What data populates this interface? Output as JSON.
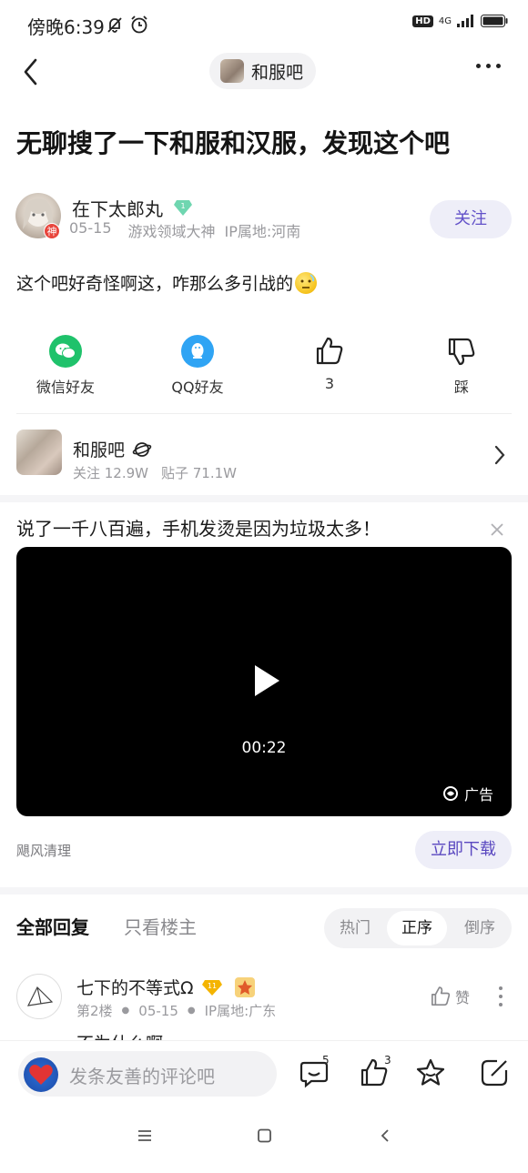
{
  "status_bar": {
    "time": "傍晚6:39",
    "hd": "HD",
    "network": "4G"
  },
  "header": {
    "forum_name": "和服吧"
  },
  "post": {
    "title": "无聊搜了一下和服和汉服，发现这个吧",
    "author": {
      "name": "在下太郎丸",
      "level": "1",
      "avatar_badge": "神",
      "date": "05-15",
      "title": "游戏领域大神",
      "ip": "IP属地:河南"
    },
    "follow_label": "关注",
    "body": "这个吧好奇怪啊这，咋那么多引战的"
  },
  "share": {
    "wechat": "微信好友",
    "qq": "QQ好友",
    "like_count": "3",
    "dislike": "踩"
  },
  "forum_card": {
    "name": "和服吧",
    "followers": "关注 12.9W",
    "posts": "贴子 71.1W"
  },
  "ad": {
    "title": "说了一千八百遍，手机发烫是因为垃圾太多！",
    "duration": "00:22",
    "tag": "广告",
    "advertiser": "飓风清理",
    "download_label": "立即下载"
  },
  "replies": {
    "tab_all": "全部回复",
    "tab_op": "只看楼主",
    "sort": [
      "热门",
      "正序",
      "倒序"
    ],
    "sort_active": "正序",
    "first": {
      "name": "七下的不等式Ω",
      "level": "11",
      "floor": "第2楼",
      "date": "05-15",
      "ip": "IP属地:广东",
      "like_label": "赞",
      "preview": "不为什么啊"
    }
  },
  "bottom_bar": {
    "placeholder": "发条友善的评论吧",
    "comment_count": "5",
    "like_count": "3"
  },
  "colors": {
    "accent": "#6150c8",
    "wechat": "#1fc26b",
    "qq": "#2fa4f4"
  }
}
